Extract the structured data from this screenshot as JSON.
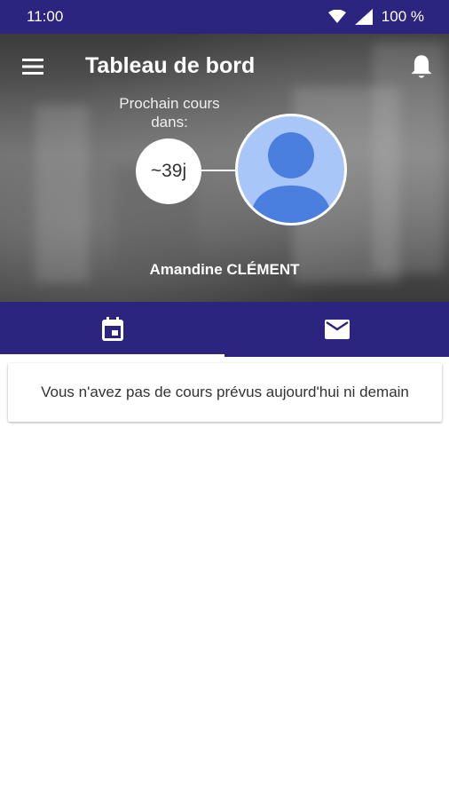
{
  "status_bar": {
    "time": "11:00",
    "battery": "100 %",
    "icons": [
      "wifi-icon",
      "signal-icon",
      "battery-icon"
    ]
  },
  "header": {
    "title": "Tableau de bord",
    "menu_icon": "menu-icon",
    "notification_icon": "bell-icon"
  },
  "countdown": {
    "label": "Prochain cours dans:",
    "value": "~39j"
  },
  "user": {
    "name": "Amandine CLÉMENT",
    "avatar_icon": "person-placeholder-icon"
  },
  "tabs": [
    {
      "icon": "calendar-icon",
      "active": true
    },
    {
      "icon": "mail-icon",
      "active": false
    }
  ],
  "content": {
    "empty_message": "Vous n'avez pas de cours prévus aujourd'hui ni demain"
  },
  "colors": {
    "primary": "#2b2580",
    "avatar_bg": "#a9c6f8",
    "avatar_figure": "#4a7fe0"
  }
}
